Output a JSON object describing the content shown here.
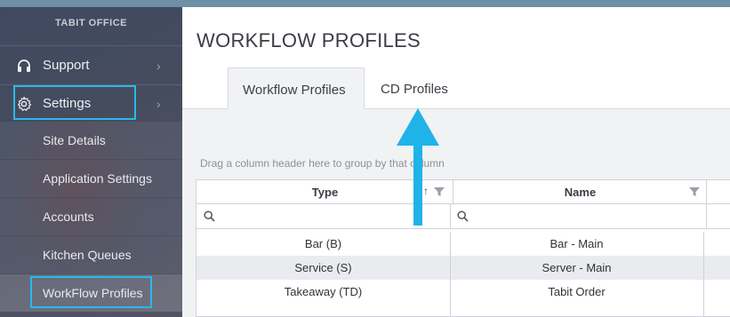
{
  "sidebar": {
    "brand": "TABIT OFFICE",
    "items": [
      {
        "label": "Support",
        "icon": "headset-icon"
      },
      {
        "label": "Settings",
        "icon": "gear-icon"
      }
    ],
    "sub_items": [
      {
        "label": "Site Details"
      },
      {
        "label": "Application Settings"
      },
      {
        "label": "Accounts"
      },
      {
        "label": "Kitchen Queues"
      },
      {
        "label": "WorkFlow Profiles"
      }
    ]
  },
  "main": {
    "title": "WORKFLOW PROFILES",
    "tabs": [
      {
        "label": "Workflow Profiles",
        "active": true
      },
      {
        "label": "CD Profiles",
        "active": false
      }
    ],
    "group_hint": "Drag a column header here to group by that column",
    "grid": {
      "columns": [
        "Type",
        "Name"
      ],
      "rows": [
        [
          "Bar (B)",
          "Bar - Main"
        ],
        [
          "Service (S)",
          "Server - Main"
        ],
        [
          "Takeaway (TD)",
          "Tabit Order"
        ]
      ]
    }
  },
  "colors": {
    "highlight": "#2bb8ea",
    "sidebar_bg": "#444b5e"
  }
}
